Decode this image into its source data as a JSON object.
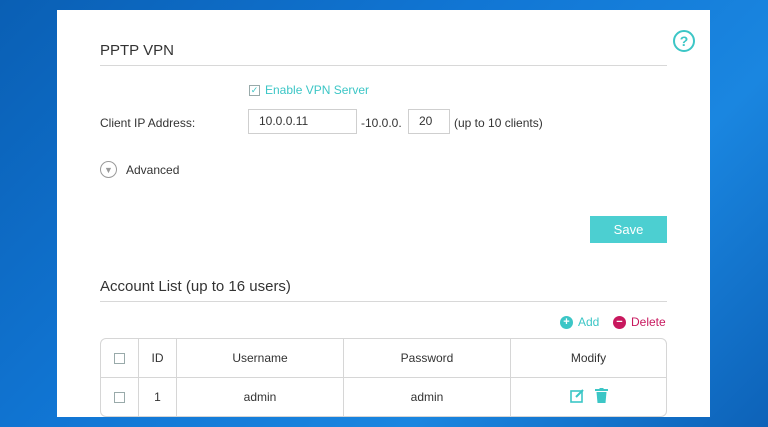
{
  "pptp": {
    "title": "PPTP VPN",
    "enable_label": "Enable VPN Server",
    "enable_checked": true,
    "client_ip_label": "Client IP Address:",
    "client_ip_start": "10.0.0.11",
    "range_prefix": "-10.0.0.",
    "client_ip_end": "20",
    "range_note": "(up to 10 clients)",
    "advanced_label": "Advanced",
    "save_label": "Save"
  },
  "accounts": {
    "title": "Account List (up to 16 users)",
    "add_label": "Add",
    "delete_label": "Delete",
    "columns": [
      "ID",
      "Username",
      "Password",
      "Modify"
    ],
    "rows": [
      {
        "id": "1",
        "username": "admin",
        "password": "admin"
      }
    ]
  },
  "colors": {
    "accent": "#4ccfd1",
    "delete": "#c8185e",
    "desktop": "#1176d4"
  },
  "icons": [
    "help-icon",
    "chevron-down-icon",
    "add-icon",
    "delete-icon",
    "edit-icon",
    "trash-icon"
  ]
}
